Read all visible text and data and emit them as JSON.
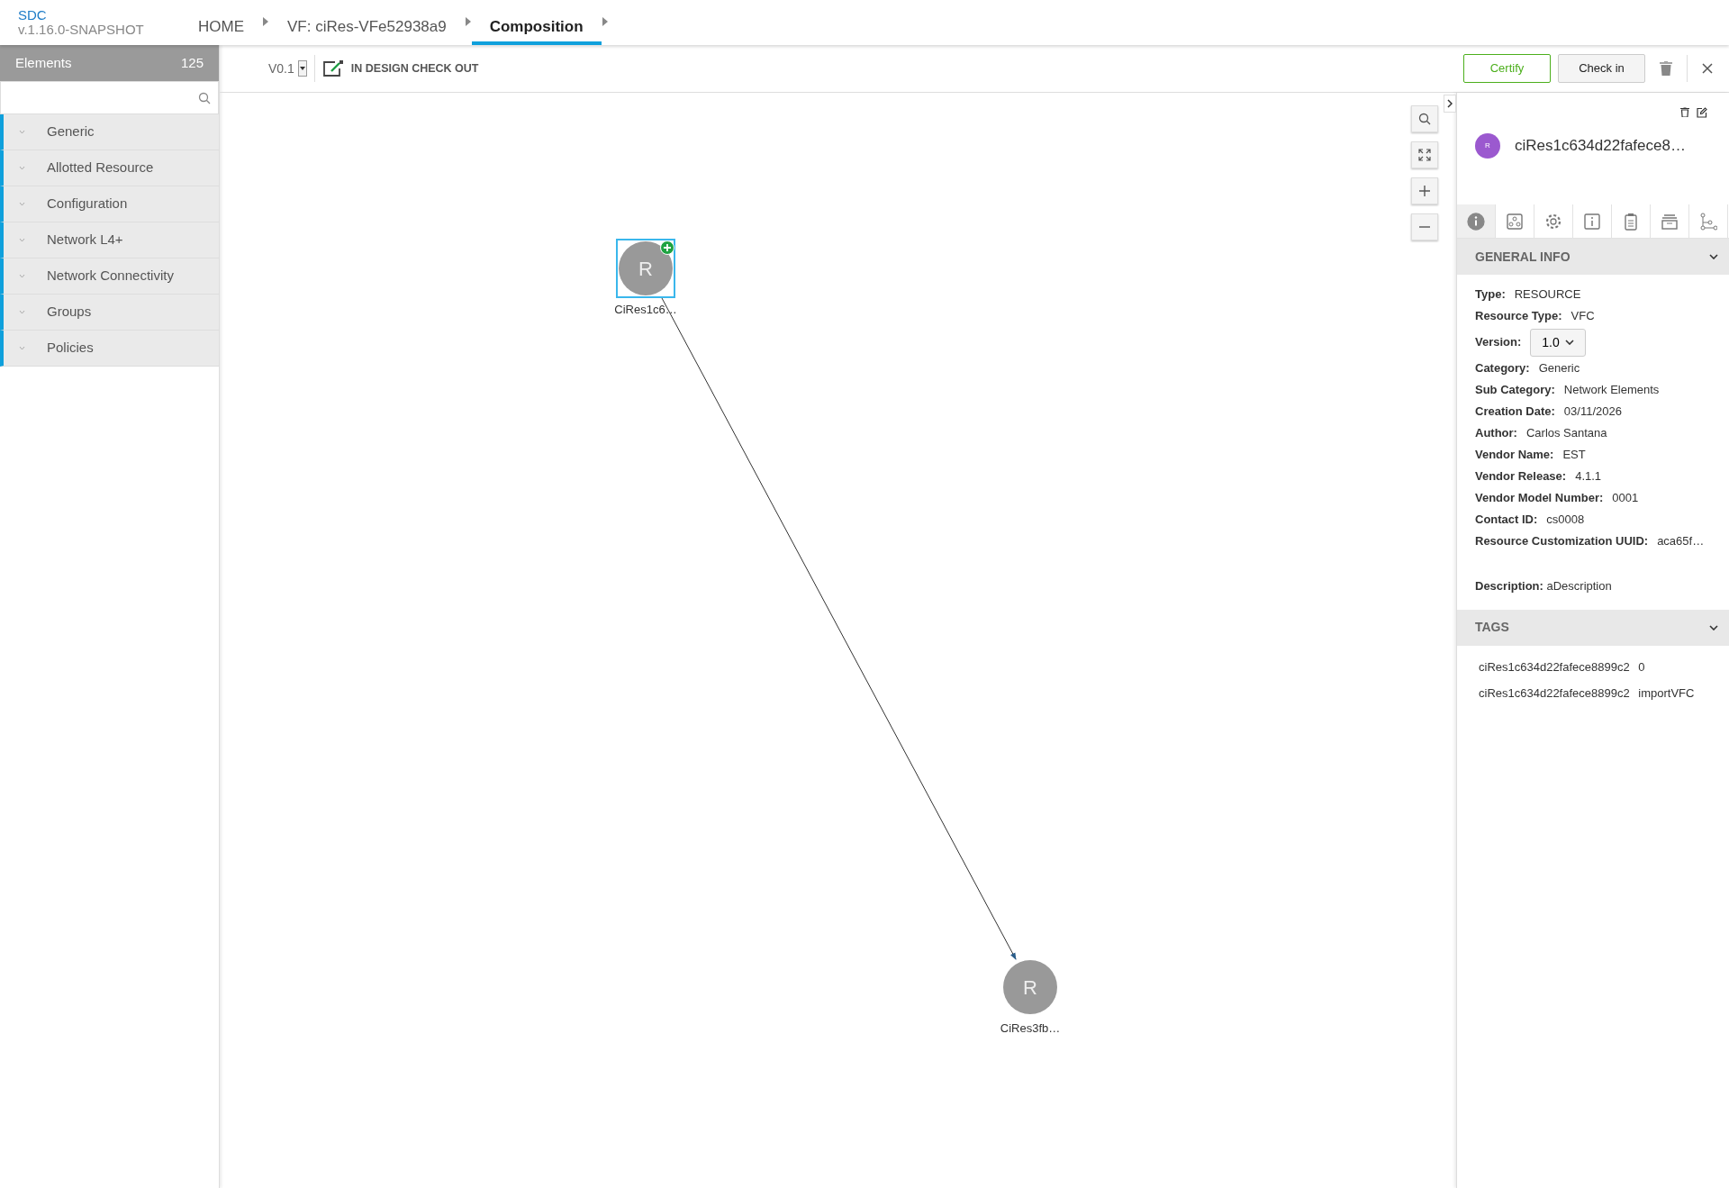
{
  "app": {
    "name": "SDC",
    "version": "v.1.16.0-SNAPSHOT"
  },
  "breadcrumbs": [
    {
      "label": "HOME",
      "selected": false
    },
    {
      "label": "VF: ciRes-VFe52938a9",
      "selected": false
    },
    {
      "label": "Composition",
      "selected": true
    }
  ],
  "palette": {
    "title": "Elements",
    "count": "125",
    "categories": [
      {
        "label": "Generic"
      },
      {
        "label": "Allotted Resource"
      },
      {
        "label": "Configuration"
      },
      {
        "label": "Network L4+"
      },
      {
        "label": "Network Connectivity"
      },
      {
        "label": "Groups"
      },
      {
        "label": "Policies"
      }
    ]
  },
  "toolbar": {
    "version": "V0.1",
    "status": "IN DESIGN CHECK OUT",
    "buttons": [
      {
        "label": "Certify",
        "kind": "outline"
      },
      {
        "label": "Check in",
        "kind": "plain"
      }
    ]
  },
  "canvas": {
    "nodes": [
      {
        "letter": "R",
        "label": "CiRes1c6…",
        "selected": true
      },
      {
        "letter": "R",
        "label": "CiRes3fb…",
        "selected": false
      }
    ]
  },
  "details": {
    "letter": "R",
    "name": "ciRes1c634d22fafece8…",
    "tabs": [
      {
        "kind": "info",
        "selected": true
      },
      {
        "kind": "composition",
        "selected": false
      },
      {
        "kind": "settings",
        "selected": false
      },
      {
        "kind": "inputs",
        "selected": false
      },
      {
        "kind": "artifacts",
        "selected": false
      },
      {
        "kind": "groups",
        "selected": false
      },
      {
        "kind": "paths",
        "selected": false
      }
    ],
    "general": {
      "title": "GENERAL INFO",
      "expanded": true,
      "fields": [
        {
          "label": "Type:",
          "value": "RESOURCE",
          "kind": "text"
        },
        {
          "label": "Resource Type:",
          "value": "VFC",
          "kind": "text"
        },
        {
          "label": "Version:",
          "value": "1.0",
          "kind": "select"
        },
        {
          "label": "Category:",
          "value": "Generic",
          "kind": "text"
        },
        {
          "label": "Sub Category:",
          "value": "Network Elements",
          "kind": "text"
        },
        {
          "label": "Creation Date:",
          "value": "03/11/2026",
          "kind": "text"
        },
        {
          "label": "Author:",
          "value": "Carlos Santana",
          "kind": "text"
        },
        {
          "label": "Vendor Name:",
          "value": "EST",
          "kind": "text"
        },
        {
          "label": "Vendor Release:",
          "value": "4.1.1",
          "kind": "text"
        },
        {
          "label": "Vendor Model Number:",
          "value": "0001",
          "kind": "text"
        },
        {
          "label": "Contact ID:",
          "value": "cs0008",
          "kind": "text"
        },
        {
          "label": "Resource Customization UUID:",
          "value": "aca65f…",
          "kind": "text"
        }
      ],
      "description": "**Description:** aDescription"
    },
    "tags": {
      "title": "TAGS",
      "expanded": true,
      "items": [
        "ciRes1c634d22fafece8899c2 0",
        "ciRes1c634d22fafece8899c2 importVFC"
      ]
    }
  }
}
